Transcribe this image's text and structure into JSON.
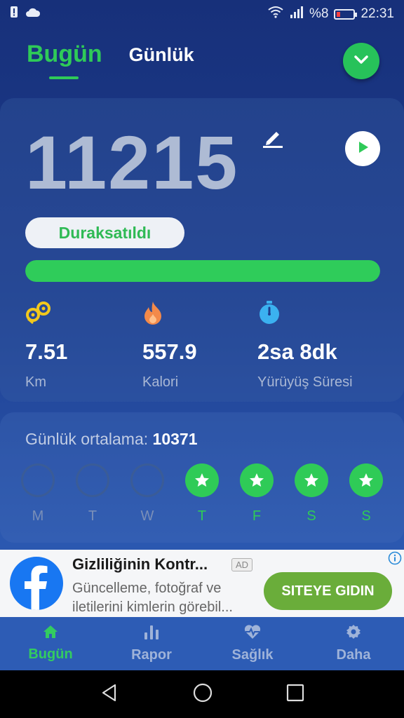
{
  "status_bar": {
    "signal_text": "%8",
    "time": "22:31"
  },
  "header": {
    "tabs": [
      {
        "label": "Bugün",
        "active": true
      },
      {
        "label": "Günlük",
        "active": false
      }
    ]
  },
  "today": {
    "steps": "11215",
    "status_label": "Duraksatıldı",
    "progress_fraction": 1.0,
    "stats": [
      {
        "icon": "distance-icon",
        "value": "7.51",
        "label": "Km"
      },
      {
        "icon": "flame-icon",
        "value": "557.9",
        "label": "Kalori"
      },
      {
        "icon": "stopwatch-icon",
        "value": "2sa 8dk",
        "label": "Yürüyüş Süresi"
      }
    ]
  },
  "weekly": {
    "average_label": "Günlük ortalama:",
    "average_value": "10371",
    "days": [
      {
        "label": "M",
        "achieved": false
      },
      {
        "label": "T",
        "achieved": false
      },
      {
        "label": "W",
        "achieved": false
      },
      {
        "label": "T",
        "achieved": true
      },
      {
        "label": "F",
        "achieved": true
      },
      {
        "label": "S",
        "achieved": true
      },
      {
        "label": "S",
        "achieved": true
      }
    ]
  },
  "ad": {
    "title": "Gizliliğinin Kontr...",
    "badge": "AD",
    "body": "Güncelleme, fotoğraf ve iletilerini kimlerin görebil...",
    "cta": "SITEYE GIDIN"
  },
  "bottom_nav": [
    {
      "label": "Bugün",
      "icon": "home-icon",
      "active": true
    },
    {
      "label": "Rapor",
      "icon": "bar-chart-icon",
      "active": false
    },
    {
      "label": "Sağlık",
      "icon": "heart-pulse-icon",
      "active": false
    },
    {
      "label": "Daha",
      "icon": "gear-icon",
      "active": false
    }
  ],
  "colors": {
    "accent_green": "#2fca58",
    "background_top": "#17307a",
    "background_bottom": "#2f5fb8"
  }
}
